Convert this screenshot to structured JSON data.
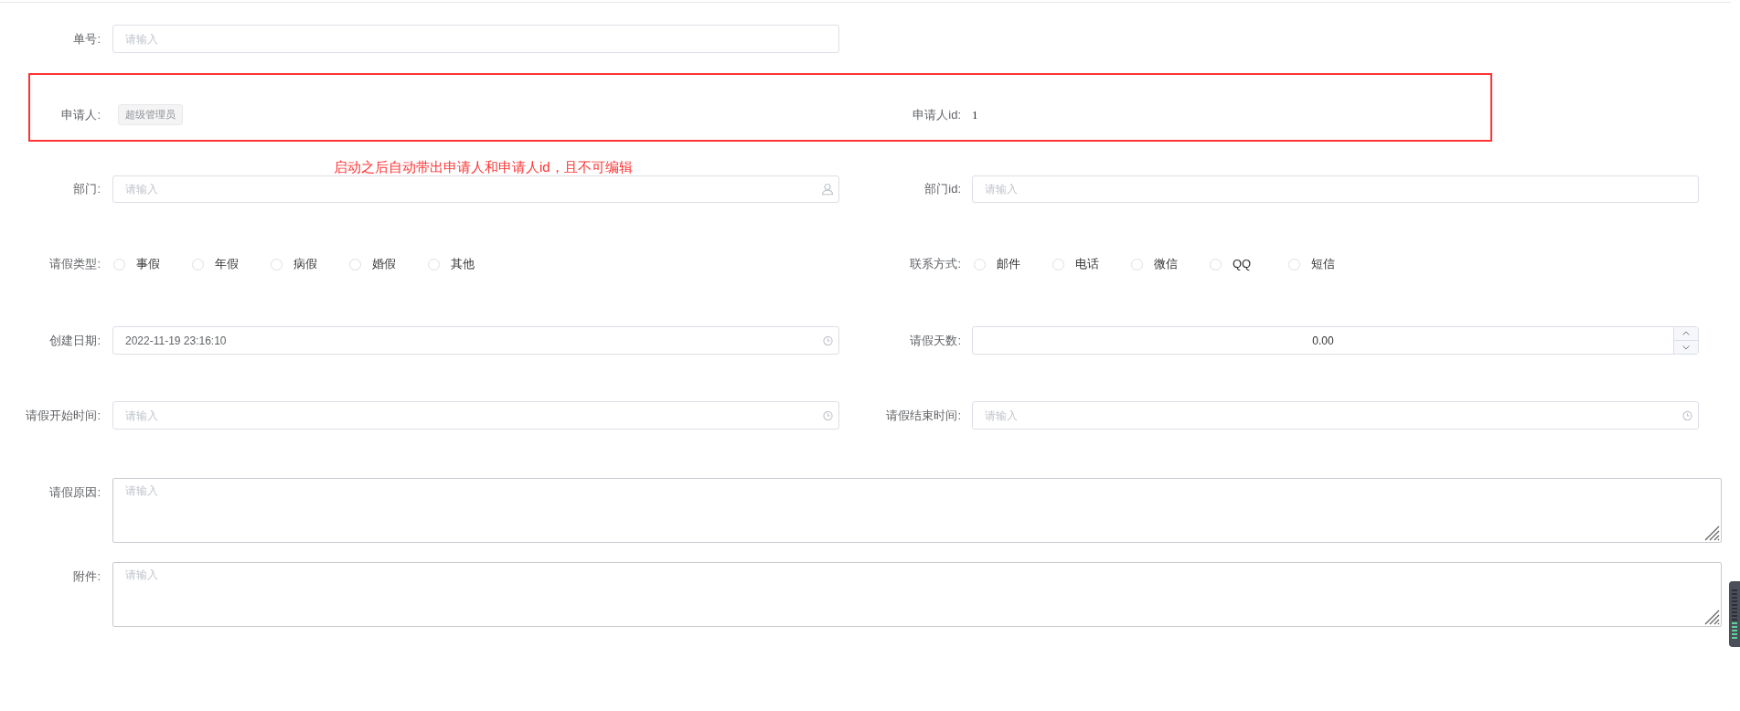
{
  "rows": [
    {
      "highlight": false,
      "fields": [
        {
          "kind": "text",
          "label": "单号:",
          "placeholder": "请输入"
        }
      ]
    },
    {
      "highlight": true,
      "fields": [
        {
          "kind": "tag",
          "label": "申请人:",
          "value": "超级管理员"
        },
        {
          "kind": "plain",
          "label": "申请人id:",
          "value": "1"
        }
      ]
    },
    {
      "highlight": false,
      "fields": [
        {
          "kind": "user_picker",
          "label": "部门:",
          "placeholder": "请输入"
        },
        {
          "kind": "text",
          "label": "部门id:",
          "placeholder": "请输入"
        }
      ]
    },
    {
      "highlight": false,
      "fields": [
        {
          "kind": "radio",
          "label": "请假类型:",
          "options": [
            {
              "label": "事假",
              "selected": false
            },
            {
              "label": "年假",
              "selected": false
            },
            {
              "label": "病假",
              "selected": false
            },
            {
              "label": "婚假",
              "selected": false
            },
            {
              "label": "其他",
              "selected": false
            }
          ]
        },
        {
          "kind": "radio",
          "label": "联系方式:",
          "options": [
            {
              "label": "邮件",
              "selected": false
            },
            {
              "label": "电话",
              "selected": false
            },
            {
              "label": "微信",
              "selected": false
            },
            {
              "label": "QQ",
              "selected": false
            },
            {
              "label": "短信",
              "selected": false
            }
          ]
        }
      ]
    },
    {
      "highlight": false,
      "fields": [
        {
          "kind": "datetime",
          "label": "创建日期:",
          "value": "2022-11-19 23:16:10"
        },
        {
          "kind": "number",
          "label": "请假天数:",
          "value": "0.00"
        }
      ]
    },
    {
      "highlight": false,
      "fields": [
        {
          "kind": "datetime",
          "label": "请假开始时间:",
          "placeholder": "请输入"
        },
        {
          "kind": "datetime",
          "label": "请假结束时间:",
          "placeholder": "请输入"
        }
      ]
    },
    {
      "highlight": false,
      "fields": [
        {
          "kind": "textarea",
          "label": "请假原因:",
          "placeholder": "请输入"
        }
      ]
    },
    {
      "highlight": false,
      "fields": [
        {
          "kind": "textarea",
          "label": "附件:",
          "placeholder": "请输入"
        }
      ]
    }
  ],
  "annotation": "启动之后自动带出申请人和申请人id，且不可编辑"
}
